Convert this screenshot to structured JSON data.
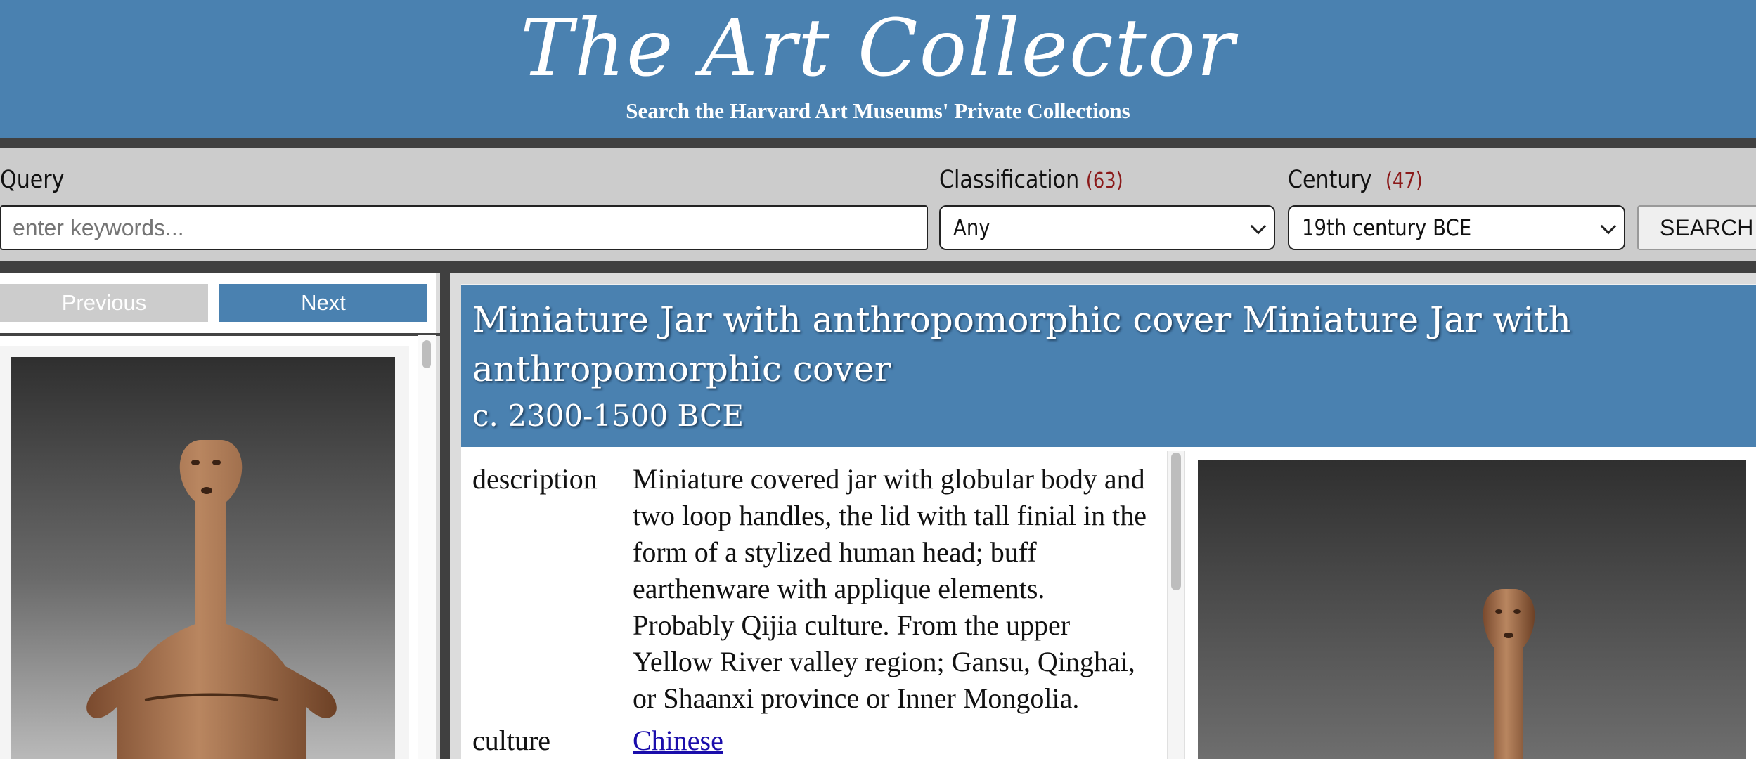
{
  "header": {
    "logo_text": "The Art Collector",
    "subtitle": "Search the Harvard Art Museums' Private Collections"
  },
  "search": {
    "query_label": "Query",
    "query_placeholder": "enter keywords...",
    "classification_label": "Classification",
    "classification_count": "(63)",
    "classification_value": "Any",
    "century_label": "Century",
    "century_count": "(47)",
    "century_value": "19th century BCE",
    "search_button": "SEARCH"
  },
  "results": {
    "previous_label": "Previous",
    "next_label": "Next"
  },
  "detail": {
    "title": "Miniature Jar with anthropomorphic cover Miniature Jar with anthropomorphic cover",
    "date": "c. 2300-1500 BCE",
    "fields": [
      {
        "key": "description",
        "value": "Miniature covered jar with globular body and two loop handles, the lid with tall finial in the form of a stylized human head; buff earthenware with applique elements. Probably Qijia culture. From the upper Yellow River valley region; Gansu, Qinghai, or Shaanxi province or Inner Mongolia."
      },
      {
        "key": "culture",
        "value": "Chinese"
      }
    ]
  },
  "colors": {
    "brand_blue": "#4a81b0",
    "dark_band": "#404040",
    "count_red": "#8b1a1a",
    "link_blue": "#1a0dab"
  }
}
